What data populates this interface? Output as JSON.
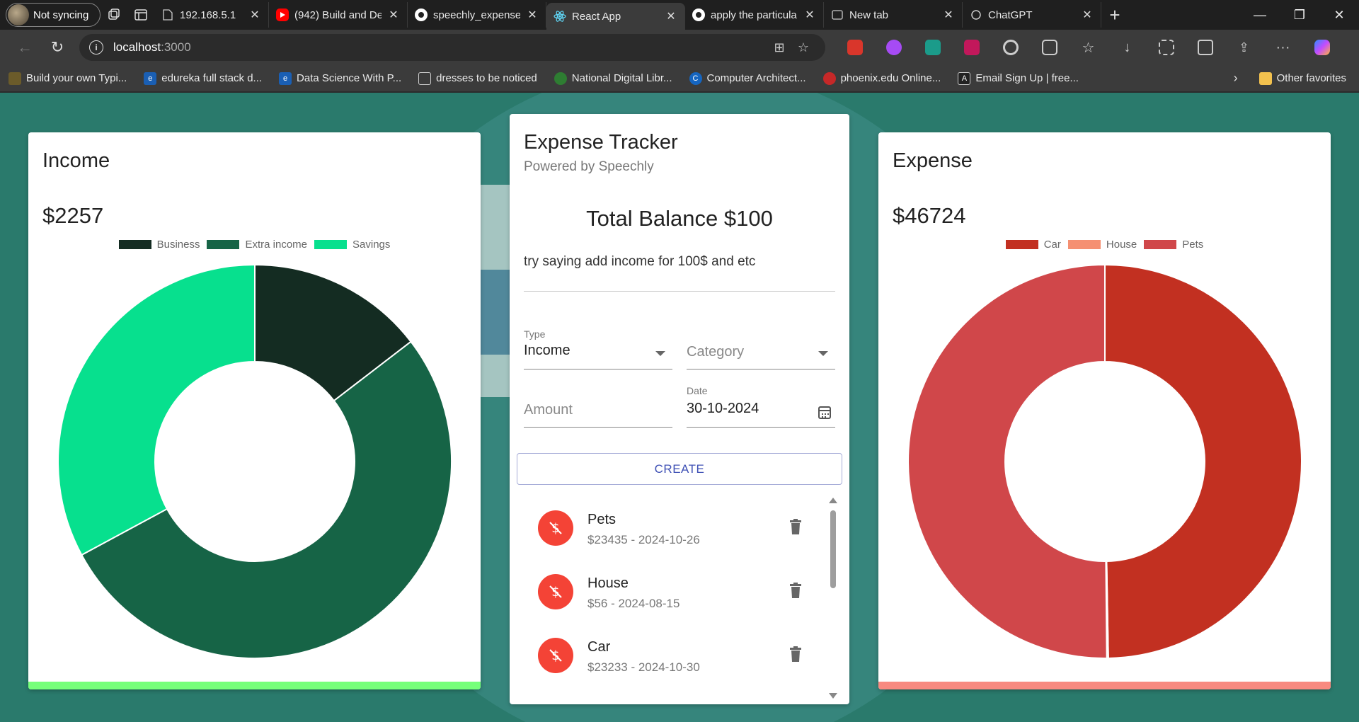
{
  "browser": {
    "profile_label": "Not syncing",
    "tabs": [
      {
        "title": "192.168.5.1",
        "icon": "page-icon"
      },
      {
        "title": "(942) Build and De",
        "icon": "youtube-icon"
      },
      {
        "title": "speechly_expense_",
        "icon": "github-icon"
      },
      {
        "title": "React App",
        "icon": "react-icon",
        "active": true
      },
      {
        "title": "apply the particula",
        "icon": "github-icon"
      },
      {
        "title": "New tab",
        "icon": "newtab-icon"
      },
      {
        "title": "ChatGPT",
        "icon": "chatgpt-icon"
      }
    ],
    "url_host": "localhost",
    "url_port": ":3000",
    "bookmarks": [
      {
        "label": "Build your own Typi...",
        "color": "#6b5b2a"
      },
      {
        "label": "edureka full stack d...",
        "color": "#1a5fb4"
      },
      {
        "label": "Data Science With P...",
        "color": "#1a5fb4"
      },
      {
        "label": "dresses to be noticed",
        "color": "#555555"
      },
      {
        "label": "National Digital Libr...",
        "color": "#2e7d32"
      },
      {
        "label": "Computer Architect...",
        "color": "#1565c0"
      },
      {
        "label": "phoenix.edu Online...",
        "color": "#c62828"
      },
      {
        "label": "Email Sign Up | free...",
        "color": "#222222"
      }
    ],
    "other_favorites": "Other favorites"
  },
  "income": {
    "title": "Income",
    "amount": "$2257",
    "legend": [
      "Business",
      "Extra income",
      "Savings"
    ],
    "bar_color": "#76ff7a"
  },
  "expense": {
    "title": "Expense",
    "amount": "$46724",
    "legend": [
      "Car",
      "House",
      "Pets"
    ],
    "bar_color": "#f88a80"
  },
  "tracker": {
    "title": "Expense Tracker",
    "subtitle": "Powered by Speechly",
    "balance": "Total Balance $100",
    "hint": "try saying add income for 100$ and etc",
    "form": {
      "type_label": "Type",
      "type_value": "Income",
      "category_placeholder": "Category",
      "amount_placeholder": "Amount",
      "date_label": "Date",
      "date_value": "30-10-2024",
      "create_label": "CREATE"
    },
    "transactions": [
      {
        "category": "Pets",
        "meta": "$23435 - 2024-10-26"
      },
      {
        "category": "House",
        "meta": "$56 - 2024-08-15"
      },
      {
        "category": "Car",
        "meta": "$23233 - 2024-10-30"
      }
    ]
  },
  "chart_data": [
    {
      "type": "pie",
      "title": "Income",
      "categories": [
        "Business",
        "Extra income",
        "Savings"
      ],
      "values": [
        329,
        1186,
        742
      ],
      "colors": [
        "#142c22",
        "#166446",
        "#07e08e"
      ]
    },
    {
      "type": "pie",
      "title": "Expense",
      "categories": [
        "Car",
        "House",
        "Pets"
      ],
      "values": [
        23233,
        56,
        23435
      ],
      "colors": [
        "#c23021",
        "#f59072",
        "#d0474a"
      ]
    }
  ]
}
